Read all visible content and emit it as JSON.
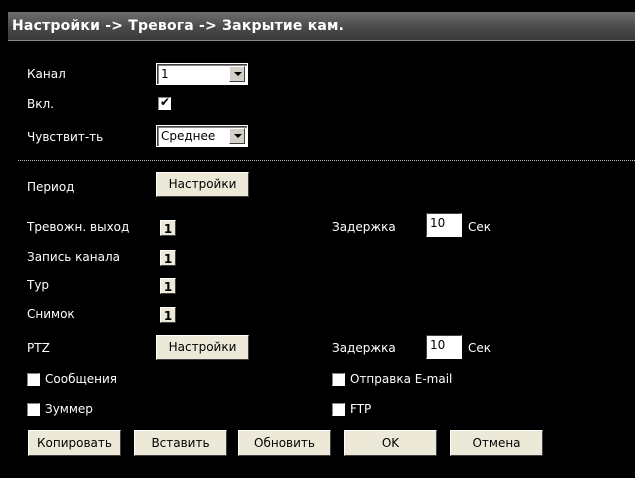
{
  "title": "Настройки -> Тревога -> Закрытие кам.",
  "channel": {
    "label": "Канал",
    "value": "1"
  },
  "enable": {
    "label": "Вкл.",
    "checked": true
  },
  "sensitivity": {
    "label": "Чувствит-ть",
    "value": "Среднее"
  },
  "period": {
    "label": "Период",
    "button": "Настройки"
  },
  "alarm_out": {
    "label": "Тревожн. выход",
    "value": "1",
    "delay_label": "Задержка",
    "delay_value": "10",
    "unit": "Сек"
  },
  "record_channel": {
    "label": "Запись канала",
    "value": "1"
  },
  "tour": {
    "label": "Тур",
    "value": "1"
  },
  "snapshot": {
    "label": "Снимок",
    "value": "1"
  },
  "ptz": {
    "label": "PTZ",
    "button": "Настройки",
    "delay_label": "Задержка",
    "delay_value": "10",
    "unit": "Сек"
  },
  "messages": {
    "label": "Сообщения",
    "checked": false
  },
  "email": {
    "label": "Отправка E-mail",
    "checked": false
  },
  "buzzer": {
    "label": "Зуммер",
    "checked": false
  },
  "ftp": {
    "label": "FTP",
    "checked": false
  },
  "buttons": {
    "copy": "Копировать",
    "paste": "Вставить",
    "refresh": "Обновить",
    "ok": "OK",
    "cancel": "Отмена"
  }
}
